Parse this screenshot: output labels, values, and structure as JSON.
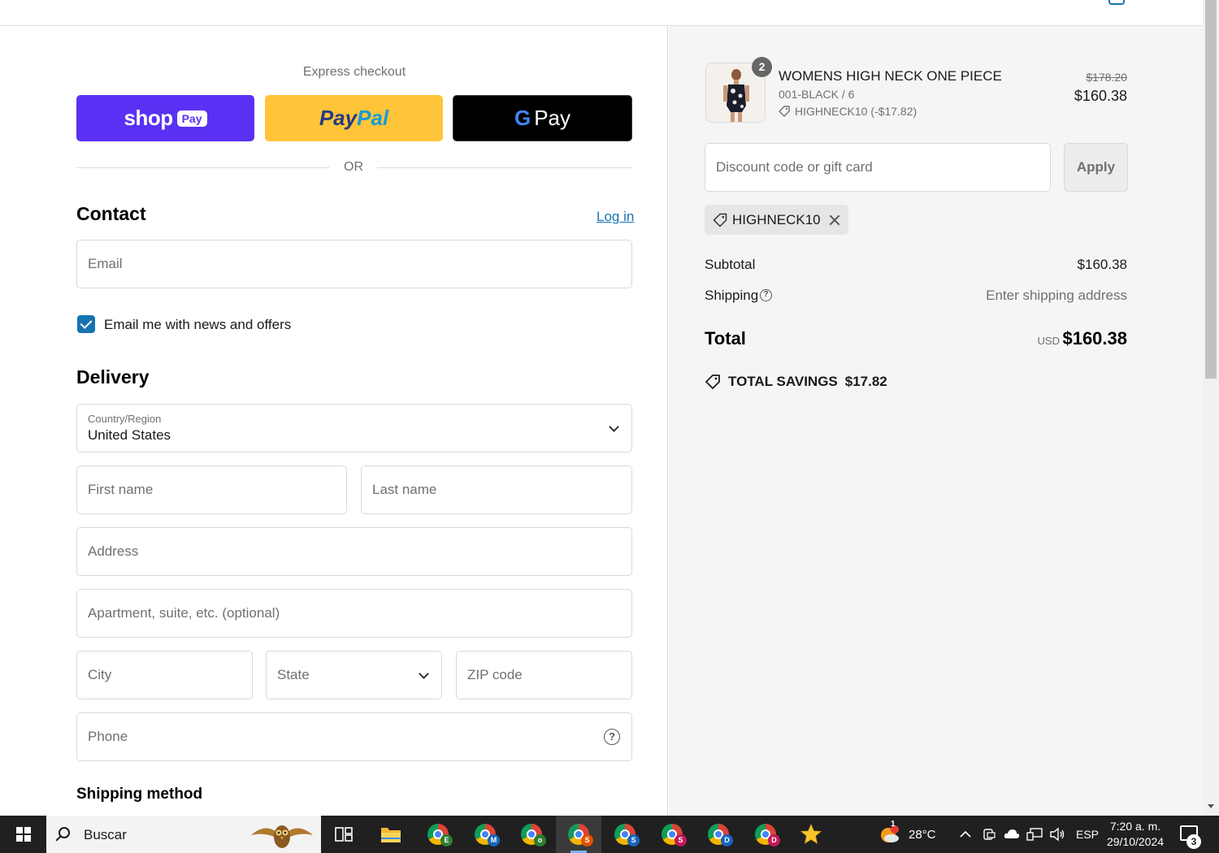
{
  "header": {
    "logo_text": ""
  },
  "express": {
    "title": "Express checkout",
    "shop_pay": {
      "word": "shop",
      "pill": "Pay"
    },
    "paypal": {
      "part1": "Pay",
      "part2": "Pal"
    },
    "gpay": {
      "g": "G",
      "word": "Pay"
    },
    "or": "OR"
  },
  "contact": {
    "heading": "Contact",
    "login_link": "Log in",
    "email_placeholder": "Email",
    "newsletter_label": "Email me with news and offers",
    "newsletter_checked": true
  },
  "delivery": {
    "heading": "Delivery",
    "country_label": "Country/Region",
    "country_value": "United States",
    "first_name_placeholder": "First name",
    "last_name_placeholder": "Last name",
    "address_placeholder": "Address",
    "apartment_placeholder": "Apartment, suite, etc. (optional)",
    "city_placeholder": "City",
    "state_label": "State",
    "zip_placeholder": "ZIP code",
    "phone_placeholder": "Phone",
    "help_glyph": "?"
  },
  "shipping_method": {
    "heading": "Shipping method"
  },
  "summary": {
    "item": {
      "quantity": "2",
      "title": "WOMENS HIGH NECK ONE PIECE",
      "variant": "001-BLACK / 6",
      "discount": "HIGHNECK10 (-$17.82)",
      "price_old": "$178.20",
      "price_new": "$160.38"
    },
    "discount_placeholder": "Discount code or gift card",
    "apply_label": "Apply",
    "applied_code": "HIGHNECK10",
    "subtotal_label": "Subtotal",
    "subtotal_value": "$160.38",
    "shipping_label": "Shipping",
    "shipping_value": "Enter shipping address",
    "total_label": "Total",
    "total_currency": "USD",
    "total_value": "$160.38",
    "savings_label": "TOTAL SAVINGS",
    "savings_value": "$17.82"
  },
  "taskbar": {
    "search_text": "Buscar",
    "apps": [
      {
        "letter": "E",
        "color": "#2e7d32"
      },
      {
        "letter": "M",
        "color": "#1565c0"
      },
      {
        "letter": "o",
        "color": "#2e7d32"
      },
      {
        "letter": "S",
        "color": "#e65100"
      },
      {
        "letter": "S",
        "color": "#1565c0"
      },
      {
        "letter": "S",
        "color": "#c2185b"
      },
      {
        "letter": "D",
        "color": "#1565c0"
      },
      {
        "letter": "D",
        "color": "#c2185b"
      }
    ],
    "weather_alert": "1",
    "temperature": "28°C",
    "language": "ESP",
    "time": "7:20 a. m.",
    "date": "29/10/2024",
    "notifications": "3"
  }
}
